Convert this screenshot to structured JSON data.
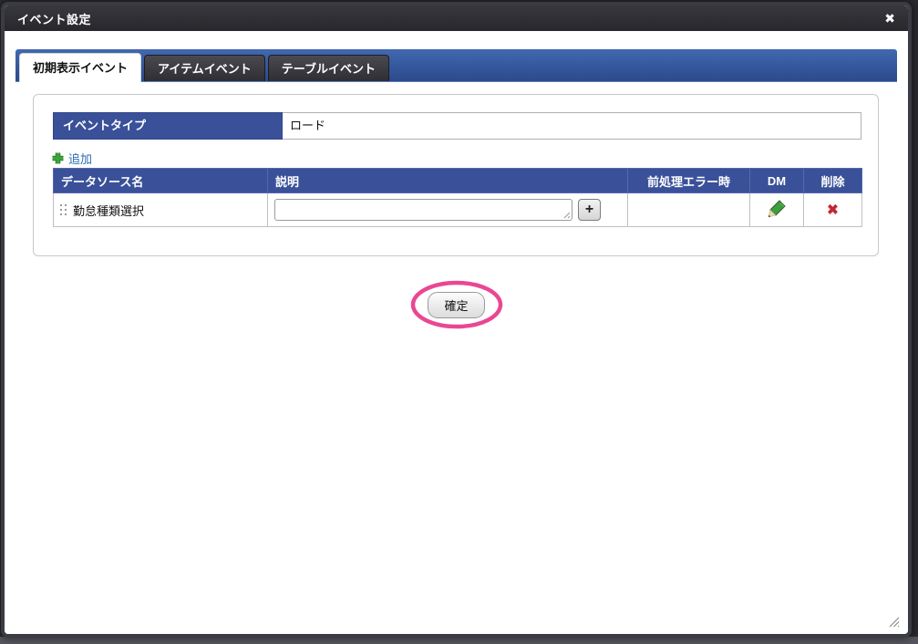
{
  "dialog": {
    "title": "イベント設定",
    "close_icon": "✖"
  },
  "tabs": [
    {
      "label": "初期表示イベント",
      "active": true
    },
    {
      "label": "アイテムイベント",
      "active": false
    },
    {
      "label": "テーブルイベント",
      "active": false
    }
  ],
  "panel": {
    "event_type": {
      "label": "イベントタイプ",
      "value": "ロード"
    },
    "add_link_label": "追加"
  },
  "table": {
    "headers": [
      "データソース名",
      "説明",
      "前処理エラー時",
      "DM",
      "削除"
    ],
    "rows": [
      {
        "datasource_name": "勤怠種類選択",
        "description": "",
        "pre_error": ""
      }
    ]
  },
  "row_icons": {
    "add_button_label": "+",
    "dm_icon": "pencil-icon",
    "delete_icon": "✖"
  },
  "footer": {
    "confirm_label": "確定"
  },
  "colors": {
    "header_blue": "#3A5199",
    "tabbar_blue_top": "#4168B1",
    "tabbar_blue_bottom": "#2B4A8B",
    "link_blue": "#2A6BB5",
    "add_plus_green": "#3CA43C",
    "pencil_green": "#3E9E3E",
    "delete_red": "#C2262E",
    "highlight_pink": "#EA4793",
    "titlebar_dark": "#2B2B30"
  }
}
